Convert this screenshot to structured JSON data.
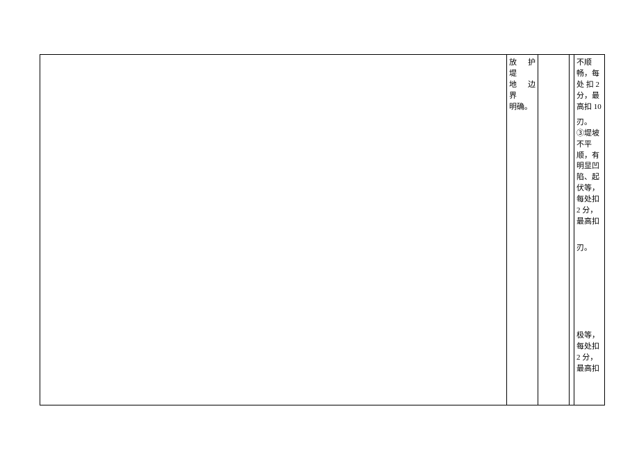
{
  "table": {
    "col_b": {
      "line1": "放 护 堤",
      "line2": "地 边 界",
      "line3": "明确。"
    },
    "col_e": {
      "p1": "不顺畅，每 处 扣 2 分，最高扣 10",
      "p1_tail": "刃。",
      "p2": "③堤坡不平顺，有明显凹陷、起伏等，每处扣 2 分，最高扣",
      "p2_tail": "刃。",
      "p3": "极等，每处扣 2 分，最高扣"
    }
  }
}
